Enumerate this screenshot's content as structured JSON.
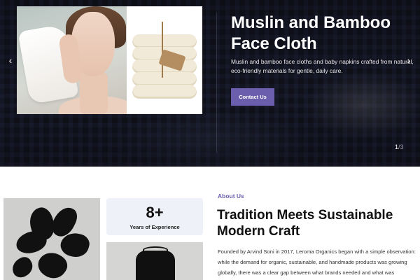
{
  "hero": {
    "title": "Muslin and Bamboo Face Cloth",
    "description": "Muslin and bamboo face cloths and baby napkins crafted from natural, eco-friendly materials for gentle, daily care.",
    "cta_label": "Contact Us",
    "prev_icon": "chevron-left-icon",
    "next_icon": "chevron-right-icon",
    "prev_glyph": "‹",
    "next_glyph": "›",
    "pager": {
      "current": "1",
      "separator": "/",
      "total": "3"
    }
  },
  "about": {
    "eyebrow": "About Us",
    "title": "Tradition Meets Sustainable Modern Craft",
    "stat_number": "8+",
    "stat_label": "Years of Experience",
    "paragraph": "Founded by Arvind Soni in 2017, Leroma Organics began with a simple observation: while the demand for organic, sustainable, and handmade products was growing globally, there was a clear gap between what brands needed and what was"
  },
  "colors": {
    "accent": "#6b5fad",
    "hero_background": "#15161f",
    "stat_card": "#eef1f8"
  }
}
